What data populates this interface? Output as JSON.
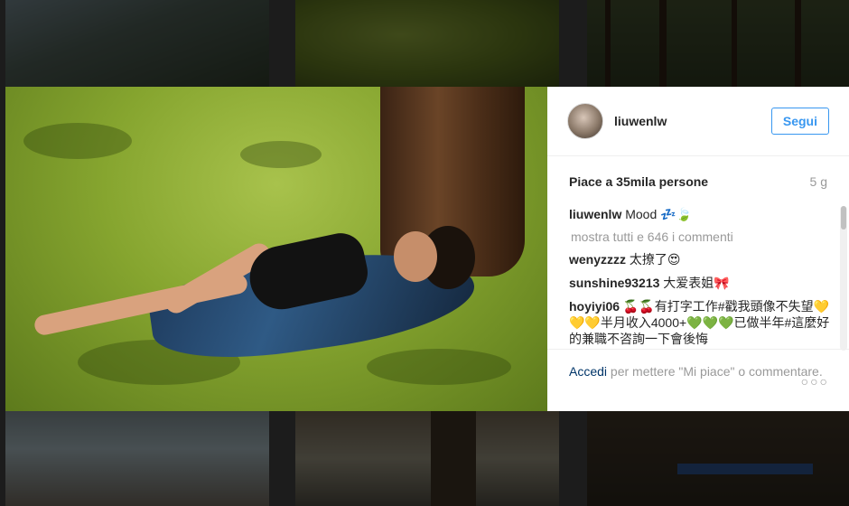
{
  "post": {
    "username": "liuwenlw",
    "follow_label": "Segui",
    "likes_text": "Piace a 35mila persone",
    "age": "5 g",
    "caption": {
      "user": "liuwenlw",
      "text": "Mood 💤🍃"
    },
    "show_all_comments": "mostra tutti e 646 i commenti",
    "comments": [
      {
        "user": "wenyzzzz",
        "text": "太撩了😍"
      },
      {
        "user": "sunshine93213",
        "text": "大爱表姐🎀"
      },
      {
        "user": "hoyiyi06",
        "text": "🍒🍒有打字工作#戳我頭像不失望💛💛💛半月收入4000+💚💚💚已做半年#這麼好的兼職不咨詢一下會後悔"
      }
    ],
    "footer": {
      "login_label": "Accedi",
      "rest_text": " per mettere \"Mi piace\" o commentare."
    },
    "more_options": "○○○"
  },
  "icons": {
    "more": "more-options-icon",
    "avatar": "avatar"
  },
  "colors": {
    "accent": "#3897f0",
    "link": "#003569",
    "muted": "#999999",
    "text": "#262626"
  }
}
